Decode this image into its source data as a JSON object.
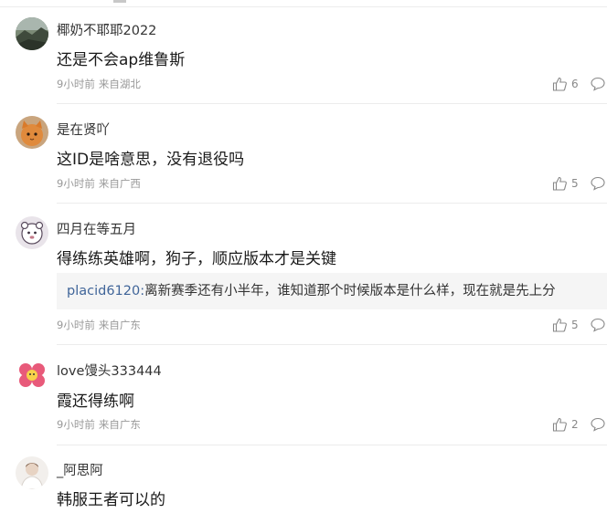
{
  "comments": [
    {
      "username": "椰奶不耶耶2022",
      "content": "还是不会ap维鲁斯",
      "time": "9小时前",
      "location": "来自湖北",
      "likes": "6",
      "avatar_icon": "avatar-dark-landscape"
    },
    {
      "username": "是在贤吖",
      "content": "这ID是啥意思，没有退役吗",
      "time": "9小时前",
      "location": "来自广西",
      "likes": "5",
      "avatar_icon": "avatar-orange-cat"
    },
    {
      "username": "四月在等五月",
      "content": "得练练英雄啊，狗子，顺应版本才是关键",
      "reply": {
        "user": "placid6120:",
        "text": "离新赛季还有小半年，谁知道那个时候版本是什么样，现在就是先上分"
      },
      "time": "9小时前",
      "location": "来自广东",
      "likes": "5",
      "avatar_icon": "avatar-cartoon-bear"
    },
    {
      "username": "love馒头333444",
      "content": "霞还得练啊",
      "time": "9小时前",
      "location": "来自广东",
      "likes": "2",
      "avatar_icon": "avatar-pink-flower"
    },
    {
      "username": "_阿思阿",
      "content": "韩服王者可以的",
      "avatar_icon": "avatar-white-figure"
    }
  ],
  "colors": {
    "link": "#406599",
    "meta": "#999999",
    "divider": "#ececec",
    "reply_bg": "#f5f5f5"
  }
}
